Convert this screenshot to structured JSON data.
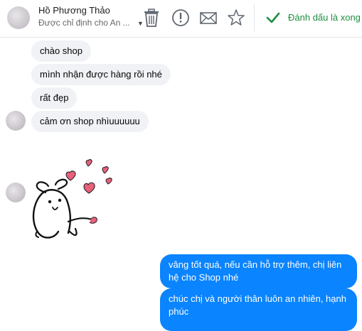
{
  "header": {
    "contact_name": "Hồ Phương Thảo",
    "assigned_to": "Được chỉ định cho An ...",
    "actions": [
      {
        "icon": "trash-icon",
        "name": "delete-button"
      },
      {
        "icon": "exclamation-icon",
        "name": "report-button"
      },
      {
        "icon": "envelope-icon",
        "name": "mark-unread-button"
      },
      {
        "icon": "star-icon",
        "name": "star-button"
      }
    ],
    "done_label": "Đánh dấu là xong"
  },
  "colors": {
    "accent_blue": "#0a84ff",
    "done_green": "#1e8e3e",
    "incoming_bubble": "#f0f2f5",
    "sticker_heart": "#e8607a"
  },
  "messages": [
    {
      "direction": "incoming",
      "text": "chào shop"
    },
    {
      "direction": "incoming",
      "text": "mình nhận được hàng rồi nhé"
    },
    {
      "direction": "incoming",
      "text": "rất đẹp"
    },
    {
      "direction": "incoming",
      "text": "cảm ơn shop nhìuuuuuu"
    },
    {
      "direction": "incoming",
      "type": "sticker",
      "sticker": "bunny-hearts-sticker"
    },
    {
      "direction": "outgoing",
      "text": "vâng tốt quá, nếu cần hỗ trợ thêm, chị liên hệ cho Shop nhé"
    },
    {
      "direction": "outgoing",
      "text": "chúc chị và người thân luôn an nhiên, hạnh phúc"
    }
  ]
}
